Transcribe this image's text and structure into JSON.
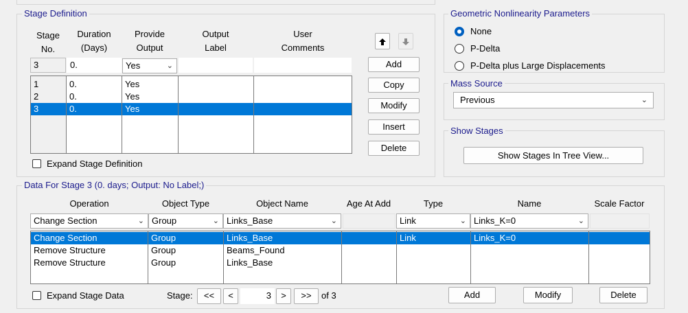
{
  "stage_definition": {
    "title": "Stage Definition",
    "headers": {
      "stage_no_1": "Stage",
      "stage_no_2": "No.",
      "duration_1": "Duration",
      "duration_2": "(Days)",
      "provide_1": "Provide",
      "provide_2": "Output",
      "label_1": "Output",
      "label_2": "Label",
      "comments_1": "User",
      "comments_2": "Comments"
    },
    "input_row": {
      "stage_no": "3",
      "duration": "0.",
      "provide_output": "Yes",
      "output_label": "",
      "user_comments": ""
    },
    "rows": [
      {
        "stage_no": "1",
        "duration": "0.",
        "provide_output": "Yes",
        "output_label": "",
        "user_comments": "",
        "selected": false
      },
      {
        "stage_no": "2",
        "duration": "0.",
        "provide_output": "Yes",
        "output_label": "",
        "user_comments": "",
        "selected": false
      },
      {
        "stage_no": "3",
        "duration": "0.",
        "provide_output": "Yes",
        "output_label": "",
        "user_comments": "",
        "selected": true
      }
    ],
    "buttons": {
      "add": "Add",
      "copy": "Copy",
      "modify": "Modify",
      "insert": "Insert",
      "delete": "Delete"
    },
    "expand_label": "Expand Stage Definition",
    "expand_checked": false
  },
  "geometric_nonlinearity": {
    "title": "Geometric Nonlinearity Parameters",
    "options": [
      {
        "label": "None",
        "selected": true
      },
      {
        "label": "P-Delta",
        "selected": false
      },
      {
        "label": "P-Delta plus Large Displacements",
        "selected": false
      }
    ]
  },
  "mass_source": {
    "title": "Mass Source",
    "value": "Previous"
  },
  "show_stages": {
    "title": "Show Stages",
    "button": "Show Stages In Tree View..."
  },
  "stage_data": {
    "title": "Data For Stage 3  (0. days;  Output: No Label;)",
    "headers": {
      "operation": "Operation",
      "object_type": "Object Type",
      "object_name": "Object Name",
      "age_at_add": "Age At Add",
      "type": "Type",
      "name": "Name",
      "scale_factor": "Scale Factor"
    },
    "input_row": {
      "operation": "Change Section",
      "object_type": "Group",
      "object_name": "Links_Base",
      "age_at_add": "",
      "type": "Link",
      "name": "Links_K=0",
      "scale_factor": ""
    },
    "rows": [
      {
        "operation": "Change Section",
        "object_type": "Group",
        "object_name": "Links_Base",
        "age_at_add": "",
        "type": "Link",
        "name": "Links_K=0",
        "scale_factor": "",
        "selected": true
      },
      {
        "operation": "Remove Structure",
        "object_type": "Group",
        "object_name": "Beams_Found",
        "age_at_add": "",
        "type": "",
        "name": "",
        "scale_factor": "",
        "selected": false
      },
      {
        "operation": "Remove Structure",
        "object_type": "Group",
        "object_name": "Links_Base",
        "age_at_add": "",
        "type": "",
        "name": "",
        "scale_factor": "",
        "selected": false
      }
    ],
    "expand_label": "Expand Stage Data",
    "expand_checked": false,
    "navigator": {
      "label": "Stage:",
      "first": "<<",
      "prev": "<",
      "value": "3",
      "next": ">",
      "last": ">>",
      "of_text": "of 3"
    },
    "buttons": {
      "add": "Add",
      "modify": "Modify",
      "delete": "Delete"
    }
  },
  "colors": {
    "selection": "#0078d7",
    "legend_text": "#1a1a8c",
    "radio_selected": "#0060c0"
  }
}
